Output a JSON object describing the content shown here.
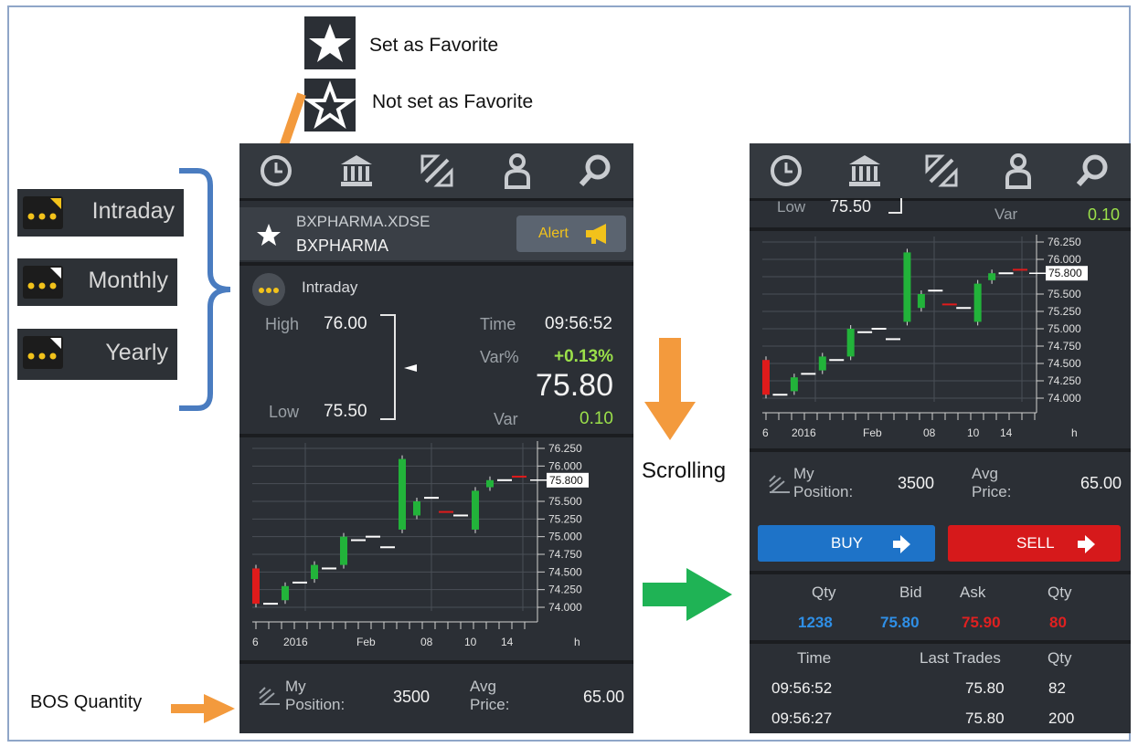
{
  "annotations": {
    "set_favorite": "Set as Favorite",
    "not_set_favorite": "Not set as Favorite",
    "scrolling": "Scrolling",
    "bos_quantity": "BOS Quantity"
  },
  "period_options": [
    {
      "label": "Intraday"
    },
    {
      "label": "Monthly"
    },
    {
      "label": "Yearly"
    }
  ],
  "nav_icons": [
    "clock-icon",
    "bank-icon",
    "exchange-icon",
    "user-icon",
    "search-icon"
  ],
  "instrument": {
    "code": "BXPHARMA.XDSE",
    "name": "BXPHARMA",
    "alert_label": "Alert"
  },
  "quote": {
    "period": "Intraday",
    "high_label": "High",
    "high": "76.00",
    "low_label": "Low",
    "low": "75.50",
    "time_label": "Time",
    "time": "09:56:52",
    "var_pct_label": "Var%",
    "var_pct": "+0.13%",
    "last": "75.80",
    "var_label": "Var",
    "var": "0.10"
  },
  "chart_data": {
    "type": "candlestick",
    "y_ticks": [
      "76.250",
      "76.000",
      "75.800",
      "75.500",
      "75.250",
      "75.000",
      "74.750",
      "74.500",
      "74.250",
      "74.000"
    ],
    "ylim": [
      74.0,
      76.25
    ],
    "last_price_label": "75.800",
    "last_price": 75.8,
    "x_labels": [
      "6",
      "2016",
      "Feb",
      "08",
      "10",
      "14",
      "h"
    ],
    "candles": [
      {
        "open": 74.55,
        "close": 74.05,
        "color": "red"
      },
      {
        "open": 74.05,
        "close": 74.05,
        "color": "white"
      },
      {
        "open": 74.1,
        "close": 74.3,
        "color": "green"
      },
      {
        "open": 74.35,
        "close": 74.35,
        "color": "white"
      },
      {
        "open": 74.4,
        "close": 74.6,
        "color": "green"
      },
      {
        "open": 74.55,
        "close": 74.55,
        "color": "white"
      },
      {
        "open": 74.6,
        "close": 75.0,
        "color": "green"
      },
      {
        "open": 74.95,
        "close": 74.95,
        "color": "white"
      },
      {
        "open": 75.0,
        "close": 75.0,
        "color": "white"
      },
      {
        "open": 74.85,
        "close": 74.85,
        "color": "white"
      },
      {
        "open": 75.1,
        "close": 76.1,
        "color": "green"
      },
      {
        "open": 75.3,
        "close": 75.5,
        "color": "green"
      },
      {
        "open": 75.55,
        "close": 75.55,
        "color": "white"
      },
      {
        "open": 75.35,
        "close": 75.35,
        "color": "red"
      },
      {
        "open": 75.3,
        "close": 75.3,
        "color": "white"
      },
      {
        "open": 75.1,
        "close": 75.65,
        "color": "green"
      },
      {
        "open": 75.7,
        "close": 75.8,
        "color": "green"
      },
      {
        "open": 75.8,
        "close": 75.8,
        "color": "white"
      },
      {
        "open": 75.85,
        "close": 75.85,
        "color": "red"
      }
    ]
  },
  "position": {
    "label_line1": "My",
    "label_line2": "Position:",
    "qty": "3500",
    "avg_line1": "Avg",
    "avg_line2": "Price:",
    "avg": "65.00"
  },
  "right_header": {
    "low_label": "Low",
    "low": "75.50",
    "var_label": "Var",
    "var": "0.10"
  },
  "trade": {
    "buy_label": "BUY",
    "sell_label": "SELL"
  },
  "order_book": {
    "headers": [
      "Qty",
      "Bid",
      "Ask",
      "Qty"
    ],
    "row": [
      "1238",
      "75.80",
      "75.90",
      "80"
    ],
    "colors": {
      "bid": "#2f8fe6",
      "ask": "#e02020"
    }
  },
  "last_trades": {
    "headers": [
      "Time",
      "Last Trades",
      "Qty"
    ],
    "rows": [
      [
        "09:56:52",
        "75.80",
        "82"
      ],
      [
        "09:56:27",
        "75.80",
        "200"
      ]
    ]
  },
  "colors": {
    "panel": "#2b2f35",
    "accent_yellow": "#f2c21b",
    "green": "#9be04a",
    "annotation_orange": "#f39a3d",
    "annotation_green": "#1fb355",
    "bracket_blue": "#4a7cc0"
  }
}
